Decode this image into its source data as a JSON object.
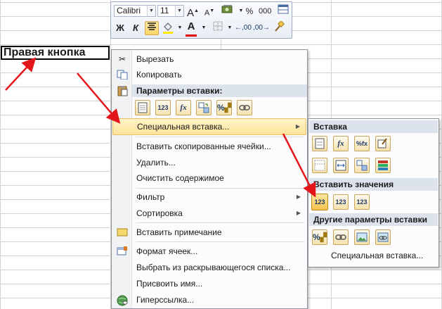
{
  "cell": {
    "text": "Правая кнопка"
  },
  "mini_toolbar": {
    "font_name": "Calibri",
    "font_size": "11",
    "grow_font": "A",
    "shrink_font": "A",
    "percent": "%",
    "thousands": "000",
    "bold": "Ж",
    "italic": "К",
    "font_color": "A",
    "inc_decimal": ",00",
    "dec_decimal": ",00"
  },
  "context_menu": {
    "cut": "Вырезать",
    "copy": "Копировать",
    "paste_options_header": "Параметры вставки:",
    "paste_icons": [
      "123",
      "fx",
      "%"
    ],
    "paste_special": "Специальная вставка...",
    "insert_copied": "Вставить скопированные ячейки...",
    "delete": "Удалить...",
    "clear": "Очистить содержимое",
    "filter": "Фильтр",
    "sort": "Сортировка",
    "insert_comment": "Вставить примечание",
    "format_cells": "Формат ячеек...",
    "pick_list": "Выбрать из раскрывающегося списка...",
    "define_name": "Присвоить имя...",
    "hyperlink": "Гиперссылка..."
  },
  "submenu": {
    "header_paste": "Вставка",
    "header_values": "Вставить значения",
    "header_other": "Другие параметры вставки",
    "paste_special_link": "Специальная вставка...",
    "icon_fx": "fx",
    "icon_pct_fx": "%fx",
    "values_icons": [
      "123",
      "123",
      "123"
    ],
    "other_pct": "%"
  },
  "colors": {
    "highlight": "#fde39a",
    "header_bg": "#dde3ec",
    "arrow": "#e3161c"
  }
}
